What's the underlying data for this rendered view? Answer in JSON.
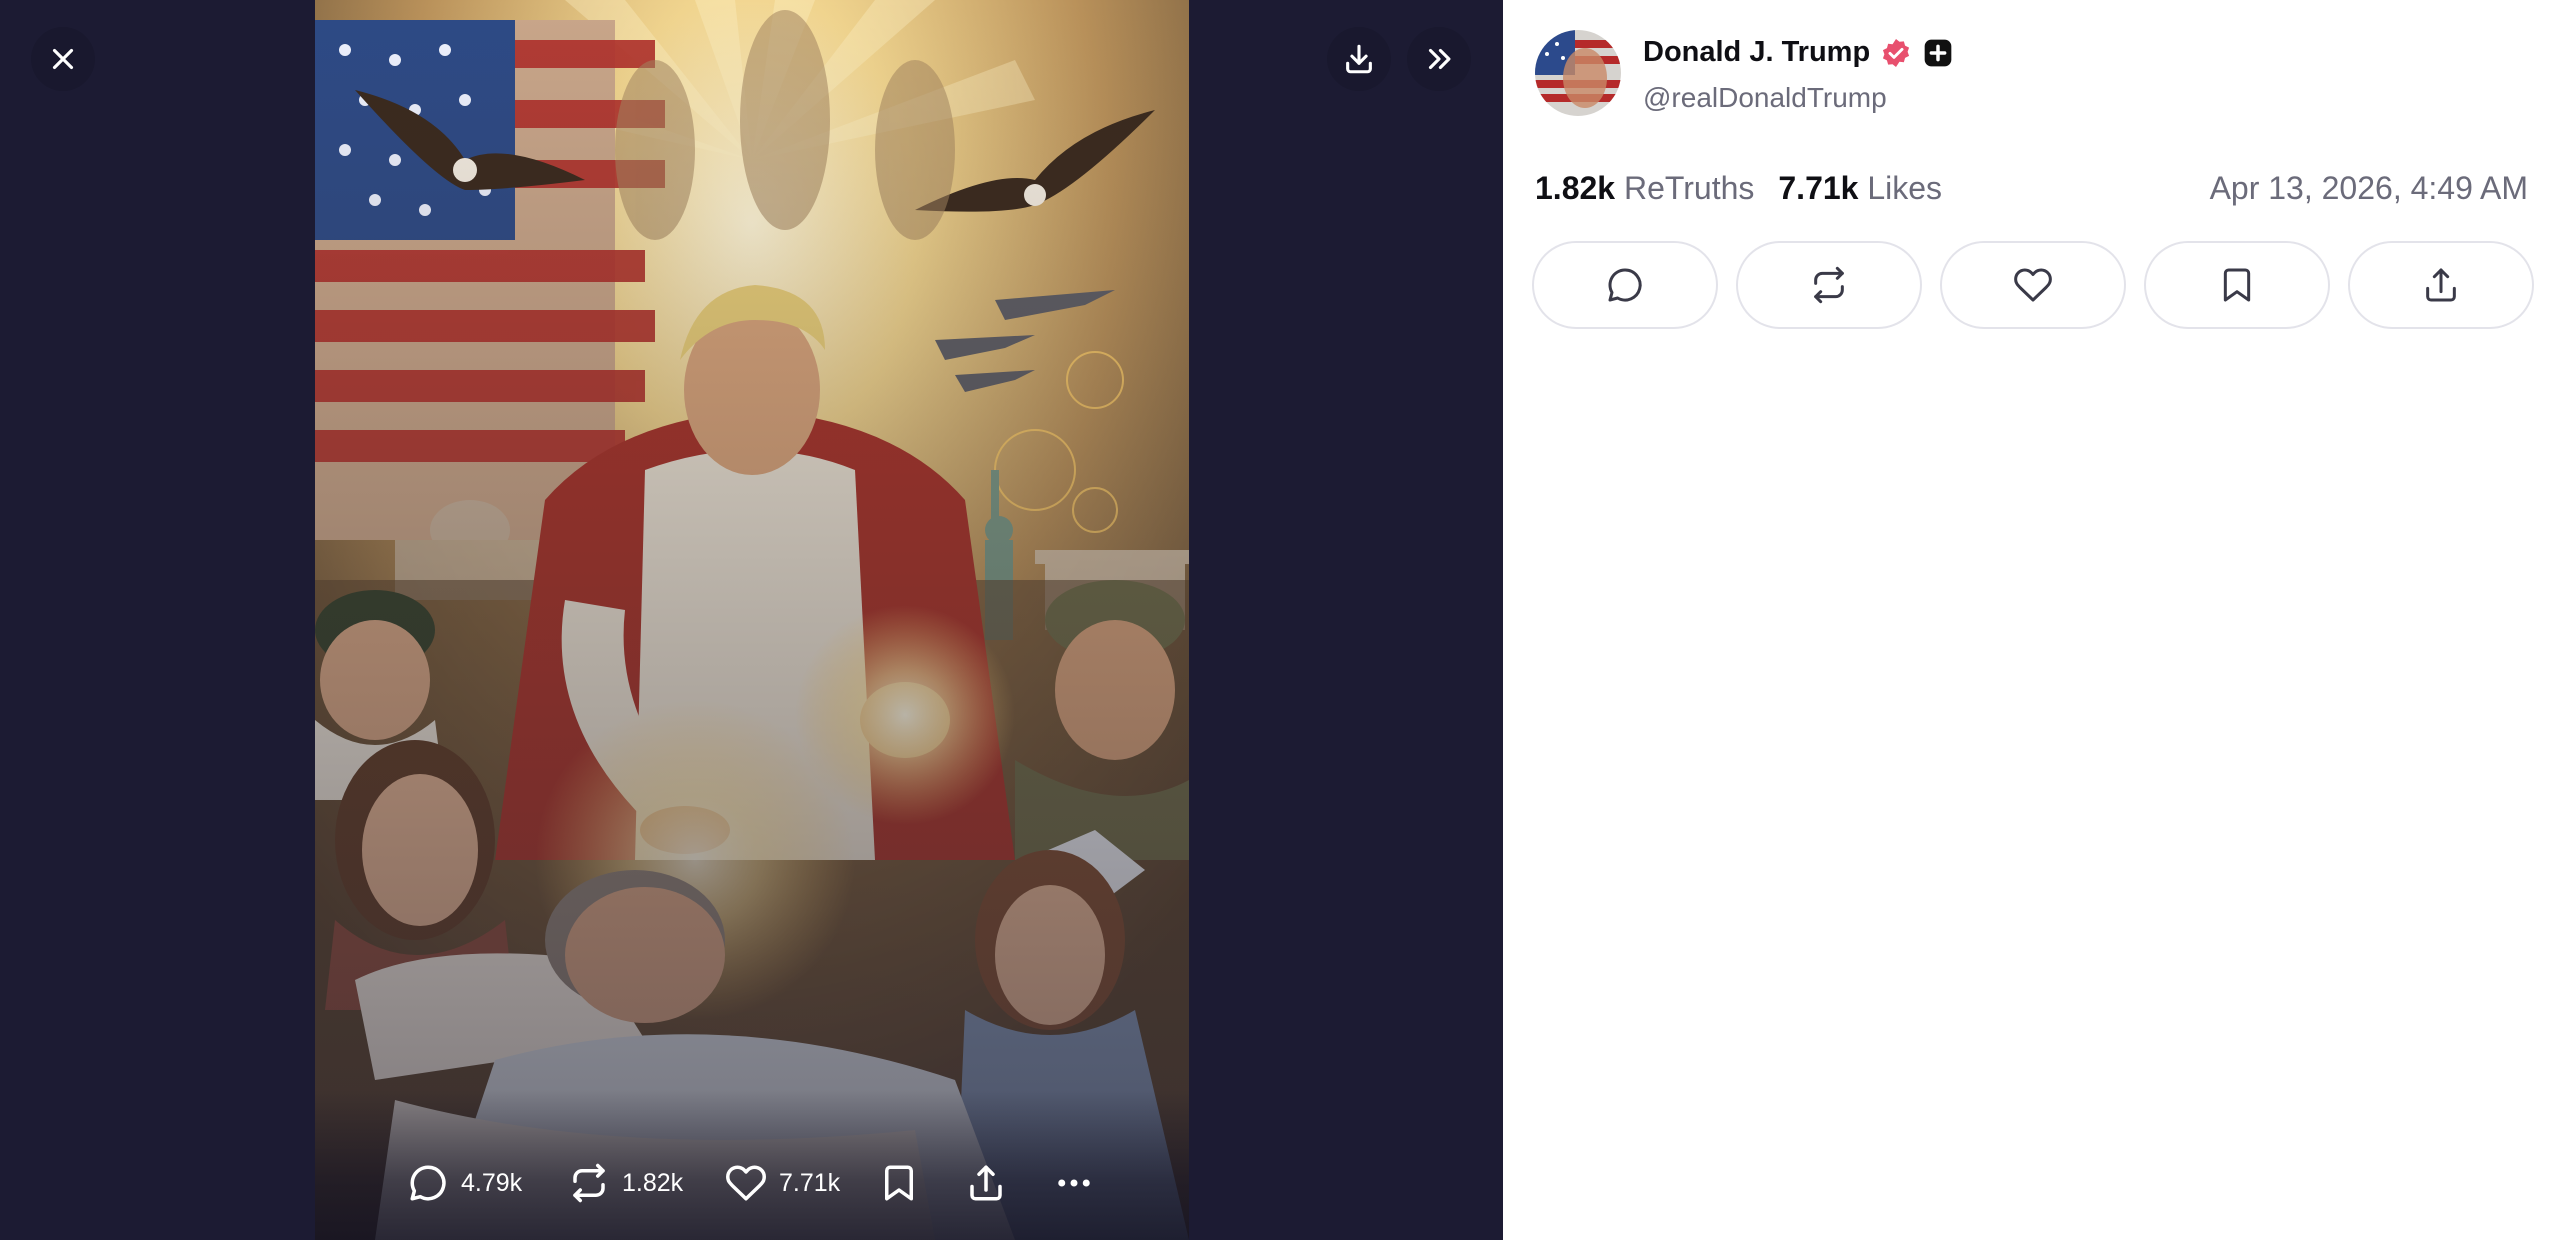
{
  "viewer": {
    "actions": [
      {
        "icon": "comment-icon",
        "count": "4.79k"
      },
      {
        "icon": "retruth-icon",
        "count": "1.82k"
      },
      {
        "icon": "heart-icon",
        "count": "7.71k"
      },
      {
        "icon": "bookmark-icon"
      },
      {
        "icon": "share-icon"
      },
      {
        "icon": "more-icon"
      }
    ]
  },
  "author": {
    "display_name": "Donald J. Trump",
    "handle": "@realDonaldTrump"
  },
  "stats": {
    "retruths_count": "1.82k",
    "retruths_label": "ReTruths",
    "likes_count": "7.71k",
    "likes_label": "Likes"
  },
  "timestamp": "Apr 13, 2026, 4:49 AM",
  "colors": {
    "viewer_bg": "#1c1b33",
    "verified_badge": "#e8506e",
    "text_primary": "#0f0f14",
    "text_secondary": "#6b6b7a"
  }
}
